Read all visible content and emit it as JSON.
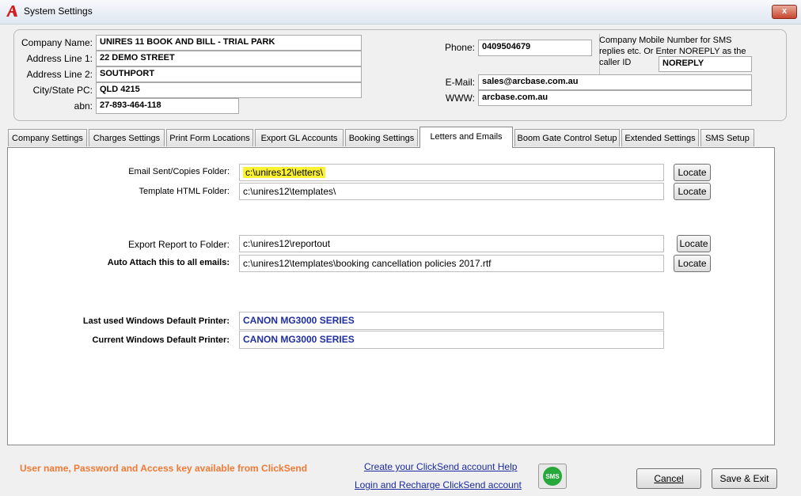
{
  "window": {
    "title": "System Settings",
    "close_label": "x"
  },
  "company": {
    "name_label": "Company Name:",
    "name": "UNIRES 11  BOOK AND BILL - TRIAL PARK",
    "addr1_label": "Address Line 1:",
    "addr1": "22 DEMO STREET",
    "addr2_label": "Address Line 2:",
    "addr2": "SOUTHPORT",
    "city_label": "City/State PC:",
    "city": "QLD 4215",
    "abn_label": "abn:",
    "abn": "27-893-464-118",
    "phone_label": "Phone:",
    "phone": "0409504679",
    "sms_note": "Company Mobile Number for SMS replies etc. Or Enter NOREPLY as the caller ID",
    "sms_caller_id": "NOREPLY",
    "email_label": "E-Mail:",
    "email": "sales@arcbase.com.au",
    "www_label": "WWW:",
    "www": "arcbase.com.au"
  },
  "tabs": [
    "Company Settings",
    "Charges Settings",
    "Print Form Locations",
    "Export GL Accounts",
    "Booking Settings",
    "Letters and Emails",
    "Boom Gate Control Setup",
    "Extended Settings",
    "SMS Setup"
  ],
  "active_tab": "Letters and Emails",
  "letters": {
    "sent_label": "Email Sent/Copies Folder:",
    "sent_value": "c:\\unires12\\letters\\",
    "template_label": "Template HTML Folder:",
    "template_value": "c:\\unires12\\templates\\",
    "export_label": "Export Report to Folder:",
    "export_value": "c:\\unires12\\reportout",
    "attach_label": "Auto Attach this to all emails:",
    "attach_value": "c:\\unires12\\templates\\booking  cancellation policies 2017.rtf",
    "locate_label": "Locate",
    "last_printer_label": "Last used Windows Default Printer:",
    "last_printer": "CANON MG3000 SERIES",
    "current_printer_label": "Current Windows Default Printer:",
    "current_printer": "CANON MG3000 SERIES"
  },
  "footer": {
    "clicksend_note": "User name, Password and Access key available from ClickSend",
    "create_link": "Create your ClickSend account Help",
    "login_link": "Login and Recharge ClickSend account",
    "sms_icon_text": "SMS",
    "cancel_label": "Cancel",
    "save_label": "Save & Exit"
  },
  "colors": {
    "highlight": "#fbf232",
    "printer_text": "#1f2fa3",
    "note_orange": "#f07a35",
    "link": "#1b2a9e"
  }
}
